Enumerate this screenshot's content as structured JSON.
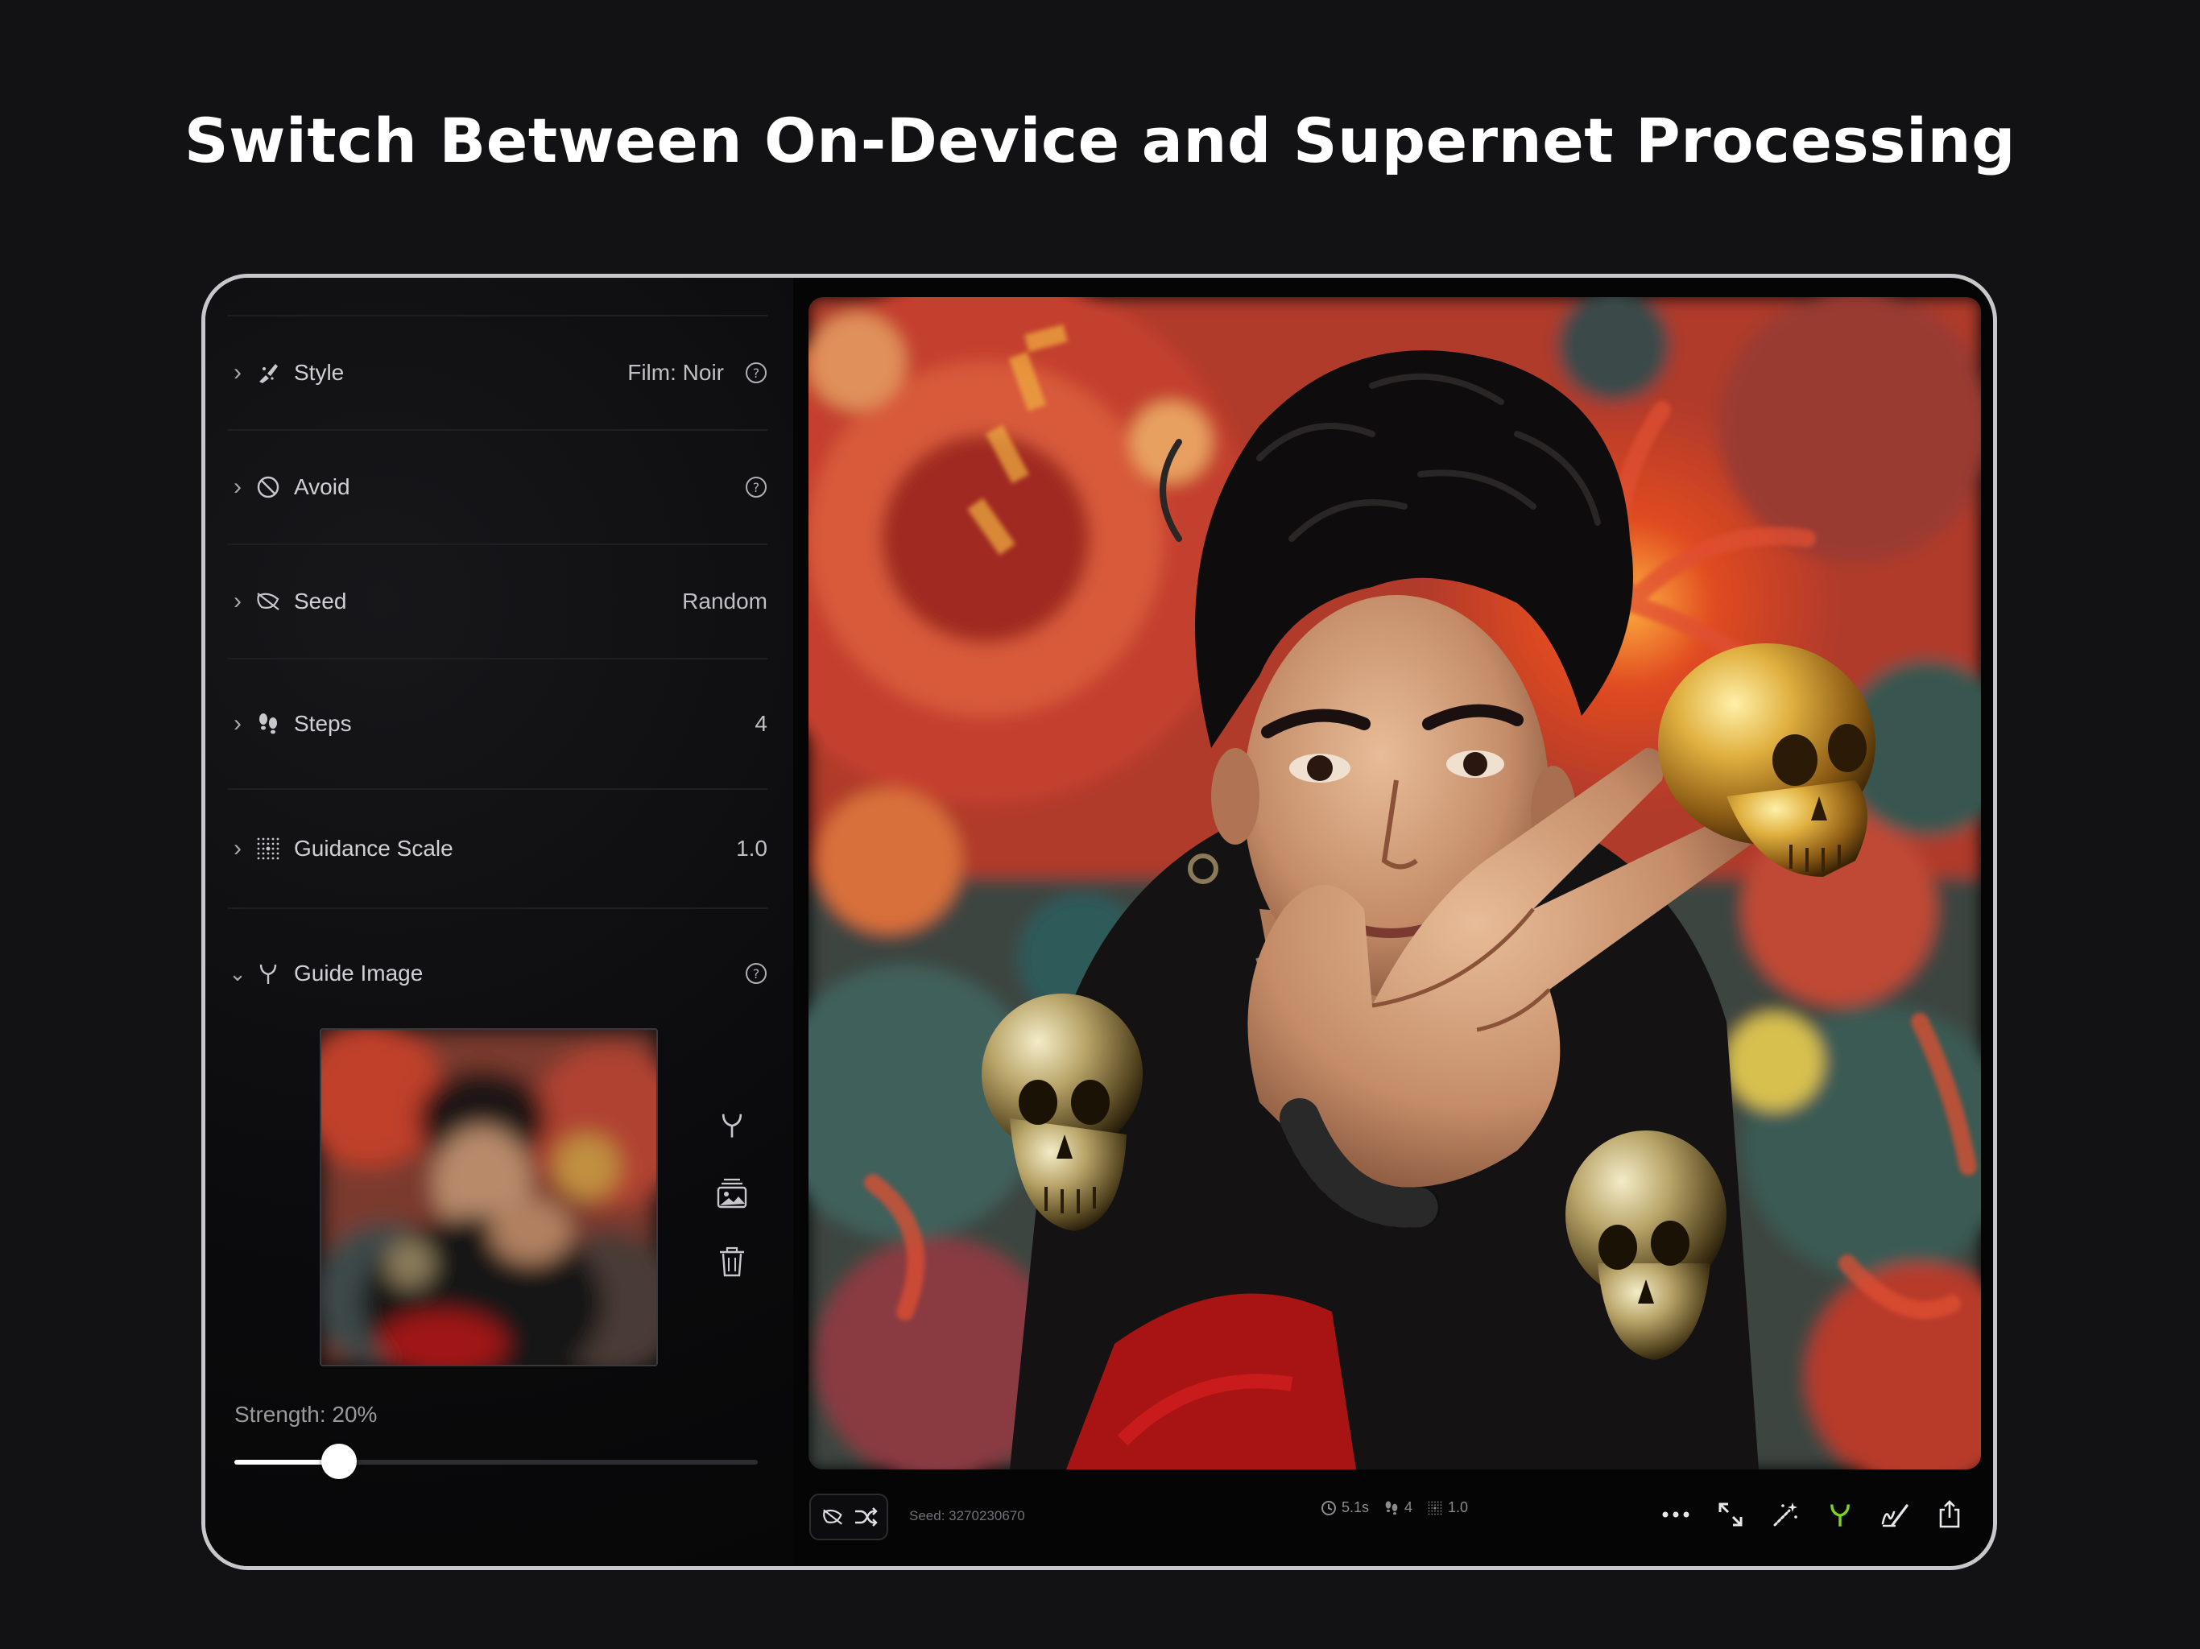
{
  "headline": "Switch Between On-Device and Supernet Processing",
  "panel": {
    "rows": [
      {
        "label": "Style",
        "value": "Film: Noir",
        "icon": "brush-icon",
        "help": true
      },
      {
        "label": "Avoid",
        "value": "",
        "icon": "prohibit-icon",
        "help": true
      },
      {
        "label": "Seed",
        "value": "Random",
        "icon": "seed-icon",
        "help": false
      },
      {
        "label": "Steps",
        "value": "4",
        "icon": "footsteps-icon",
        "help": false
      },
      {
        "label": "Guidance Scale",
        "value": "1.0",
        "icon": "dots-grid-icon",
        "help": false
      },
      {
        "label": "Guide Image",
        "value": "",
        "icon": "fork-icon",
        "help": true
      }
    ],
    "guide_image_tools": [
      "fork-icon",
      "image-stack-icon",
      "trash-icon"
    ],
    "strength_label": "Strength: 20%",
    "strength": 0.2
  },
  "toolbar": {
    "seed_text": "Seed: 3270230670",
    "stats": {
      "time": "5.1s",
      "steps": "4",
      "guidance": "1.0"
    },
    "actions": [
      "more-icon",
      "expand-icon",
      "magic-wand-icon",
      "fork-icon",
      "edit-icon",
      "share-icon"
    ],
    "accent_color": "#7ed321"
  },
  "colors": {
    "background": "#121214",
    "device_border": "#c8c8cc",
    "panel_bg": "#0b0b0d",
    "text_primary": "#d0d0d4",
    "accent": "#7ed321"
  }
}
